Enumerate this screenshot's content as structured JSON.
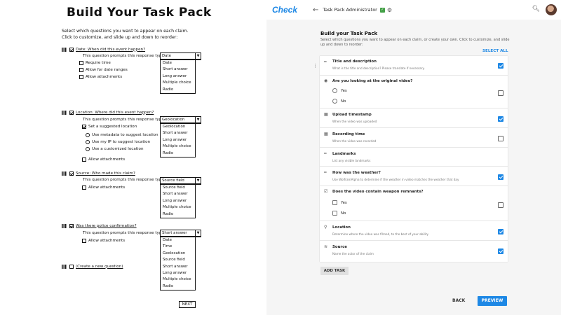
{
  "wireframe": {
    "title": "Build Your Task Pack",
    "subtitle1": "Select which questions you want to appear on each claim.",
    "subtitle2": "Click to customize, and slide up and down to reorder:",
    "prompt_text": "This question prompts this response type:",
    "q1": {
      "label": "Date: When did this event happen?",
      "current": "Date",
      "options": [
        "Date",
        "Short answer",
        "Long answer",
        "Multiple choice",
        "Radio"
      ],
      "subs": [
        "Require time",
        "Allow for date ranges",
        "Allow attachments"
      ]
    },
    "q2": {
      "label": "Location: Where did this event happen?",
      "current": "Geolocation",
      "options": [
        "Geolocation",
        "Short answer",
        "Long answer",
        "Multiple choice",
        "Radio"
      ],
      "suggest": "Set a suggested location",
      "radios": [
        "Use metadata to suggest location",
        "Use my IP to suggest location",
        "Use a customized location"
      ],
      "attach": "Allow attachments"
    },
    "q3": {
      "label": "Source: Who made this claim?",
      "current": "Source field",
      "options": [
        "Source field",
        "Short answer",
        "Long answer",
        "Multiple choice",
        "Radio"
      ],
      "attach": "Allow attachments"
    },
    "q4": {
      "label": "Was there police confirmation?",
      "current": "Short answer",
      "options": [
        "Date",
        "Time",
        "Geolocation",
        "Source field",
        "Short answer",
        "Long answer",
        "Multiple choice",
        "Radio"
      ],
      "attach": "Allow attachments"
    },
    "create": "(Create a new question)",
    "next": "NEXT"
  },
  "app": {
    "logo": "Check",
    "page_title": "Task Pack Administrator",
    "heading": "Build your Task Pack",
    "description": "Select which questions you want to appear on each claim, or create your own. Click to customize, and slide up and down to reorder:",
    "select_all": "SELECT ALL",
    "tasks": [
      {
        "title": "Title and description",
        "desc": "What is the title and description? Please translate if necessary.",
        "checked": true
      },
      {
        "title": "Are you looking at the original video?",
        "desc": "",
        "checked": false,
        "options": [
          "Yes",
          "No"
        ],
        "option_kind": "radio"
      },
      {
        "title": "Upload timestamp",
        "desc": "When the video was uploaded",
        "checked": true
      },
      {
        "title": "Recording time",
        "desc": "When the video was recorded",
        "checked": false
      },
      {
        "title": "Landmarks",
        "desc": "List any visible landmarks",
        "checked": false
      },
      {
        "title": "How was the weather?",
        "desc": "Use WolframAlpha to determine if the weather in video matches the weather that day",
        "checked": true
      },
      {
        "title": "Does the video contain weapon remnants?",
        "desc": "",
        "checked": false,
        "options": [
          "Yes",
          "No"
        ],
        "option_kind": "checkbox"
      },
      {
        "title": "Location",
        "desc": "Determine where the video was filmed, to the best of your ability",
        "checked": true
      },
      {
        "title": "Source",
        "desc": "Name the actor of the claim",
        "checked": true
      }
    ],
    "add_task": "ADD TASK",
    "back": "BACK",
    "preview": "PREVIEW",
    "accent": "#1e88e5"
  }
}
